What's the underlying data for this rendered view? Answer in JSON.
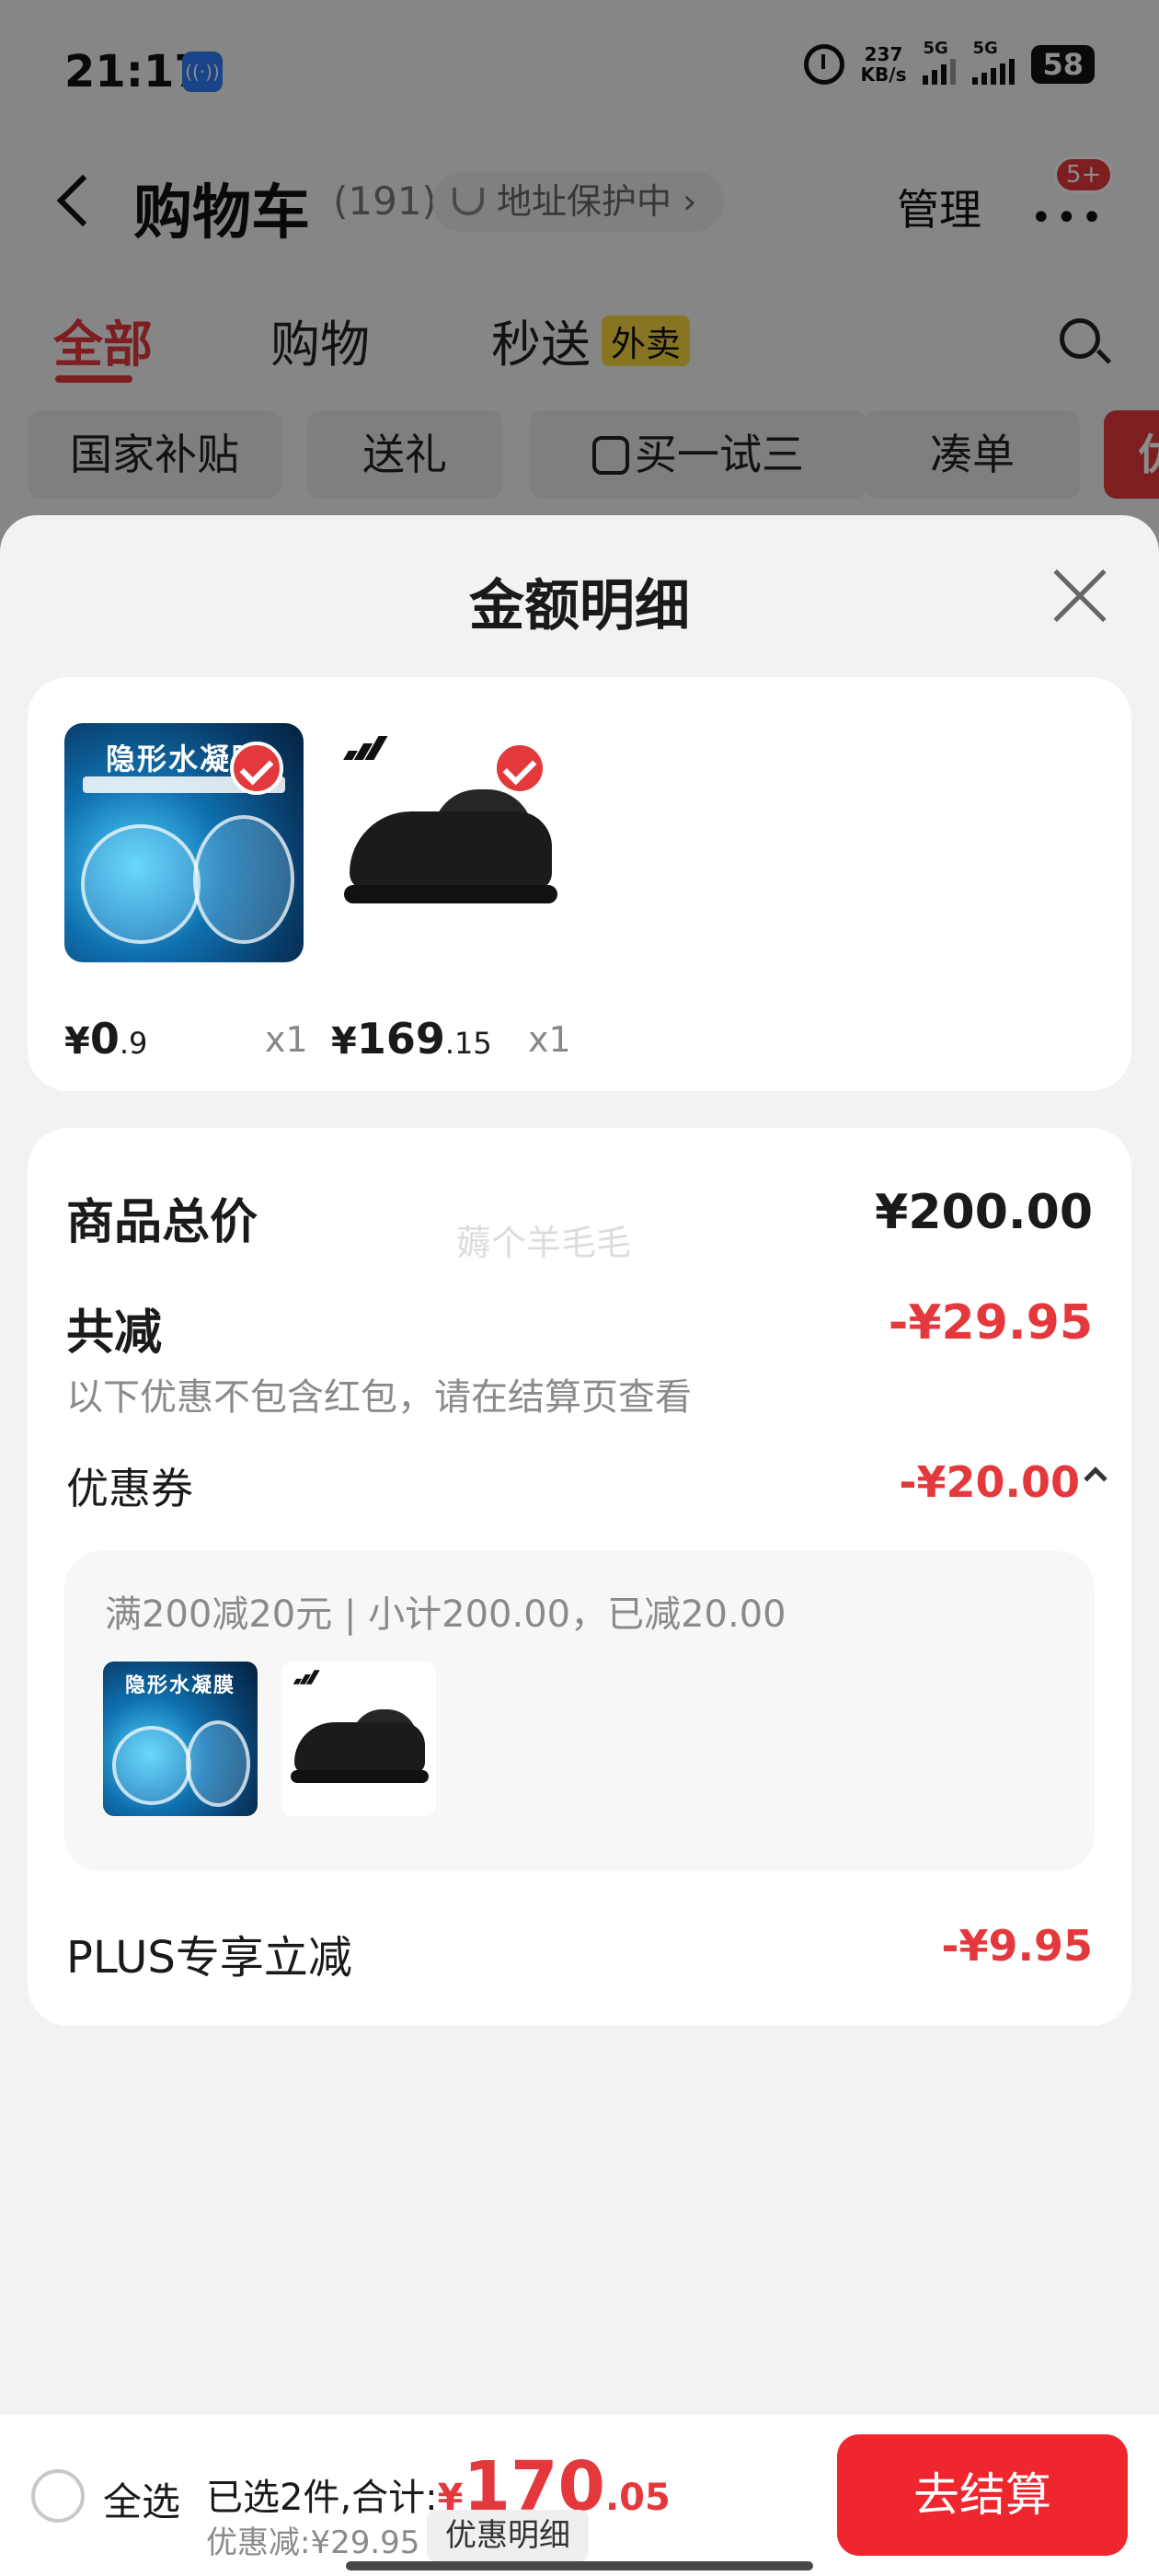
{
  "status_bar": {
    "time": "21:17",
    "net_speed_value": "237",
    "net_speed_unit": "KB/s",
    "signal1": "5G",
    "signal2": "5G",
    "battery": "58"
  },
  "header": {
    "title": "购物车",
    "count": "(191)",
    "address_status": "地址保护中",
    "manage": "管理",
    "badge": "5+"
  },
  "tabs": [
    {
      "label": "全部",
      "active": true
    },
    {
      "label": "购物",
      "active": false
    },
    {
      "label": "秒送",
      "badge": "外卖",
      "active": false
    }
  ],
  "chips": [
    "国家补贴",
    "送礼",
    "买一试三",
    "凑单",
    "优"
  ],
  "sheet": {
    "title": "金额明细",
    "products": [
      {
        "image_text": "隐形水凝膜",
        "price_int": "0",
        "price_dec": ".9",
        "currency": "¥",
        "qty": "x1",
        "image": "screen-protector",
        "checked": true
      },
      {
        "image_text": "",
        "price_int": "169",
        "price_dec": ".15",
        "currency": "¥",
        "qty": "x1",
        "image": "black-sneaker",
        "checked": true
      }
    ],
    "summary": {
      "total_label": "商品总价",
      "total_value": "¥200.00",
      "watermark": "薅个羊毛毛",
      "reduce_label": "共减",
      "reduce_value": "-¥29.95",
      "reduce_note": "以下优惠不包含红包，请在结算页查看",
      "coupon_label": "优惠券",
      "coupon_value": "-¥20.00",
      "coupon_desc": "满200减20元 | 小计200.00，已减20.00",
      "plus_label": "PLUS专享立减",
      "plus_value": "-¥9.95"
    }
  },
  "bottom_bar": {
    "select_all": "全选",
    "selected_text": "已选2件,合计:",
    "total_currency": "¥",
    "total_int": "170",
    "total_dec": ".05",
    "discount_text": "优惠减:¥29.95",
    "detail_button": "优惠明细",
    "checkout_button": "去结算"
  },
  "colors": {
    "accent": "#e4393c",
    "checkout": "#f0262f"
  }
}
